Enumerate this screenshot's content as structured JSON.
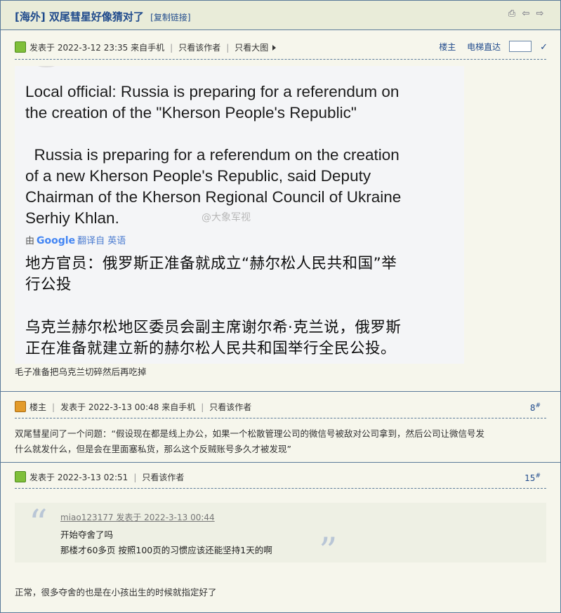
{
  "thread": {
    "title": "[海外] 双尾彗星好像猜对了",
    "copy_link": "[复制链接]",
    "icons": [
      "print-icon",
      "prev-thread-icon",
      "next-thread-icon"
    ]
  },
  "posts": [
    {
      "meta": {
        "posted": "发表于 2022-3-12 23:35 来自手机",
        "only_author": "只看该作者",
        "only_big_image": "只看大图"
      },
      "right": {
        "louzhu": "楼主",
        "elevator": "电梯直达"
      },
      "image": {
        "en_title": [
          "Local official: Russia is preparing for a referendum on",
          "the creation of the \"Kherson People's Republic\""
        ],
        "en_body": [
          "  Russia is preparing for a referendum on the creation",
          "of a new Kherson People's Republic, said Deputy",
          "Chairman of the Kherson Regional Council of Ukraine",
          "Serhiy Khlan."
        ],
        "translate_by": "由",
        "translate_google": "Google",
        "translate_from": "翻译自 英语",
        "watermark": "@大象军视",
        "cn_title": [
          "地方官员：俄罗斯正准备就成立“赫尔松人民共和国”举",
          "行公投"
        ],
        "cn_body": [
          "乌克兰赫尔松地区委员会副主席谢尔希·克兰说，俄罗斯",
          "正在准备就建立新的赫尔松人民共和国举行全民公投。"
        ]
      },
      "text": "毛子准备把乌克兰切碎然后再吃掉"
    },
    {
      "meta": {
        "louzhu": "楼主",
        "posted": "发表于 2022-3-13 00:48 来自手机",
        "only_author": "只看该作者"
      },
      "floor": "8",
      "floor_mark": "#",
      "text_lines": [
        "双尾彗星问了一个问题：“假设现在都是线上办公，如果一个松散管理公司的微信号被敌对公司拿到，然后公司让微信号发",
        "什么就发什么，但是会在里面塞私货，那么这个反贼账号多久才被发现”"
      ]
    },
    {
      "meta": {
        "posted": "发表于 2022-3-13 02:51",
        "only_author": "只看该作者"
      },
      "floor": "15",
      "floor_mark": "#",
      "quote": {
        "header": "miao123177 发表于 2022-3-13 00:44",
        "lines": [
          "开始夺舍了吗",
          "那楼才60多页  按照100页的习惯应该还能坚持1天的啊"
        ]
      },
      "text": "正常，很多夺舍的也是在小孩出生的时候就指定好了"
    }
  ]
}
